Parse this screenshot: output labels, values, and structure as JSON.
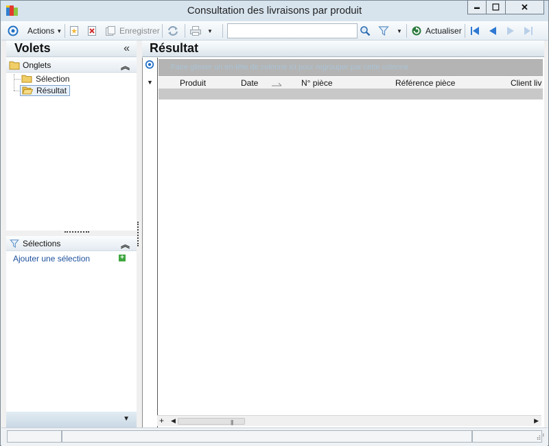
{
  "window": {
    "title": "Consultation des livraisons par produit",
    "minimize_glyph": "▬",
    "maximize_glyph": "☐",
    "close_glyph": "✕"
  },
  "toolbar": {
    "actions_label": "Actions",
    "save_label": "Enregistrer",
    "search_value": "",
    "refresh_label": "Actualiser"
  },
  "left_panel": {
    "title": "Volets",
    "collapse_glyph": "«",
    "tabs_section": {
      "title": "Onglets",
      "items": [
        {
          "label": "Sélection",
          "selected": false
        },
        {
          "label": "Résultat",
          "selected": true
        }
      ]
    },
    "selections_section": {
      "title": "Sélections",
      "add_link": "Ajouter une sélection"
    }
  },
  "result_panel": {
    "title": "Résultat",
    "groupby_hint": "Faire glisser un en-tête de colonne ici pour regrouper par cette colonne",
    "columns": [
      "Produit",
      "Date",
      "N° pièce",
      "Référence pièce",
      "Client liv"
    ],
    "sorted_column": "Date"
  },
  "colors": {
    "accent": "#1f6fc5",
    "link": "#1c4f9c",
    "title_bar": "#d7e4ee"
  },
  "icons": {
    "menu": "circle-menu-icon",
    "new": "new-document-icon",
    "delete": "delete-icon",
    "save": "save-icon",
    "sync": "sync-icon",
    "print": "printer-icon",
    "search": "magnifier-icon",
    "filter": "funnel-icon",
    "refresh": "refresh-icon",
    "first": "first-record-icon",
    "previous": "previous-record-icon",
    "next": "next-record-icon",
    "last": "last-record-icon"
  }
}
